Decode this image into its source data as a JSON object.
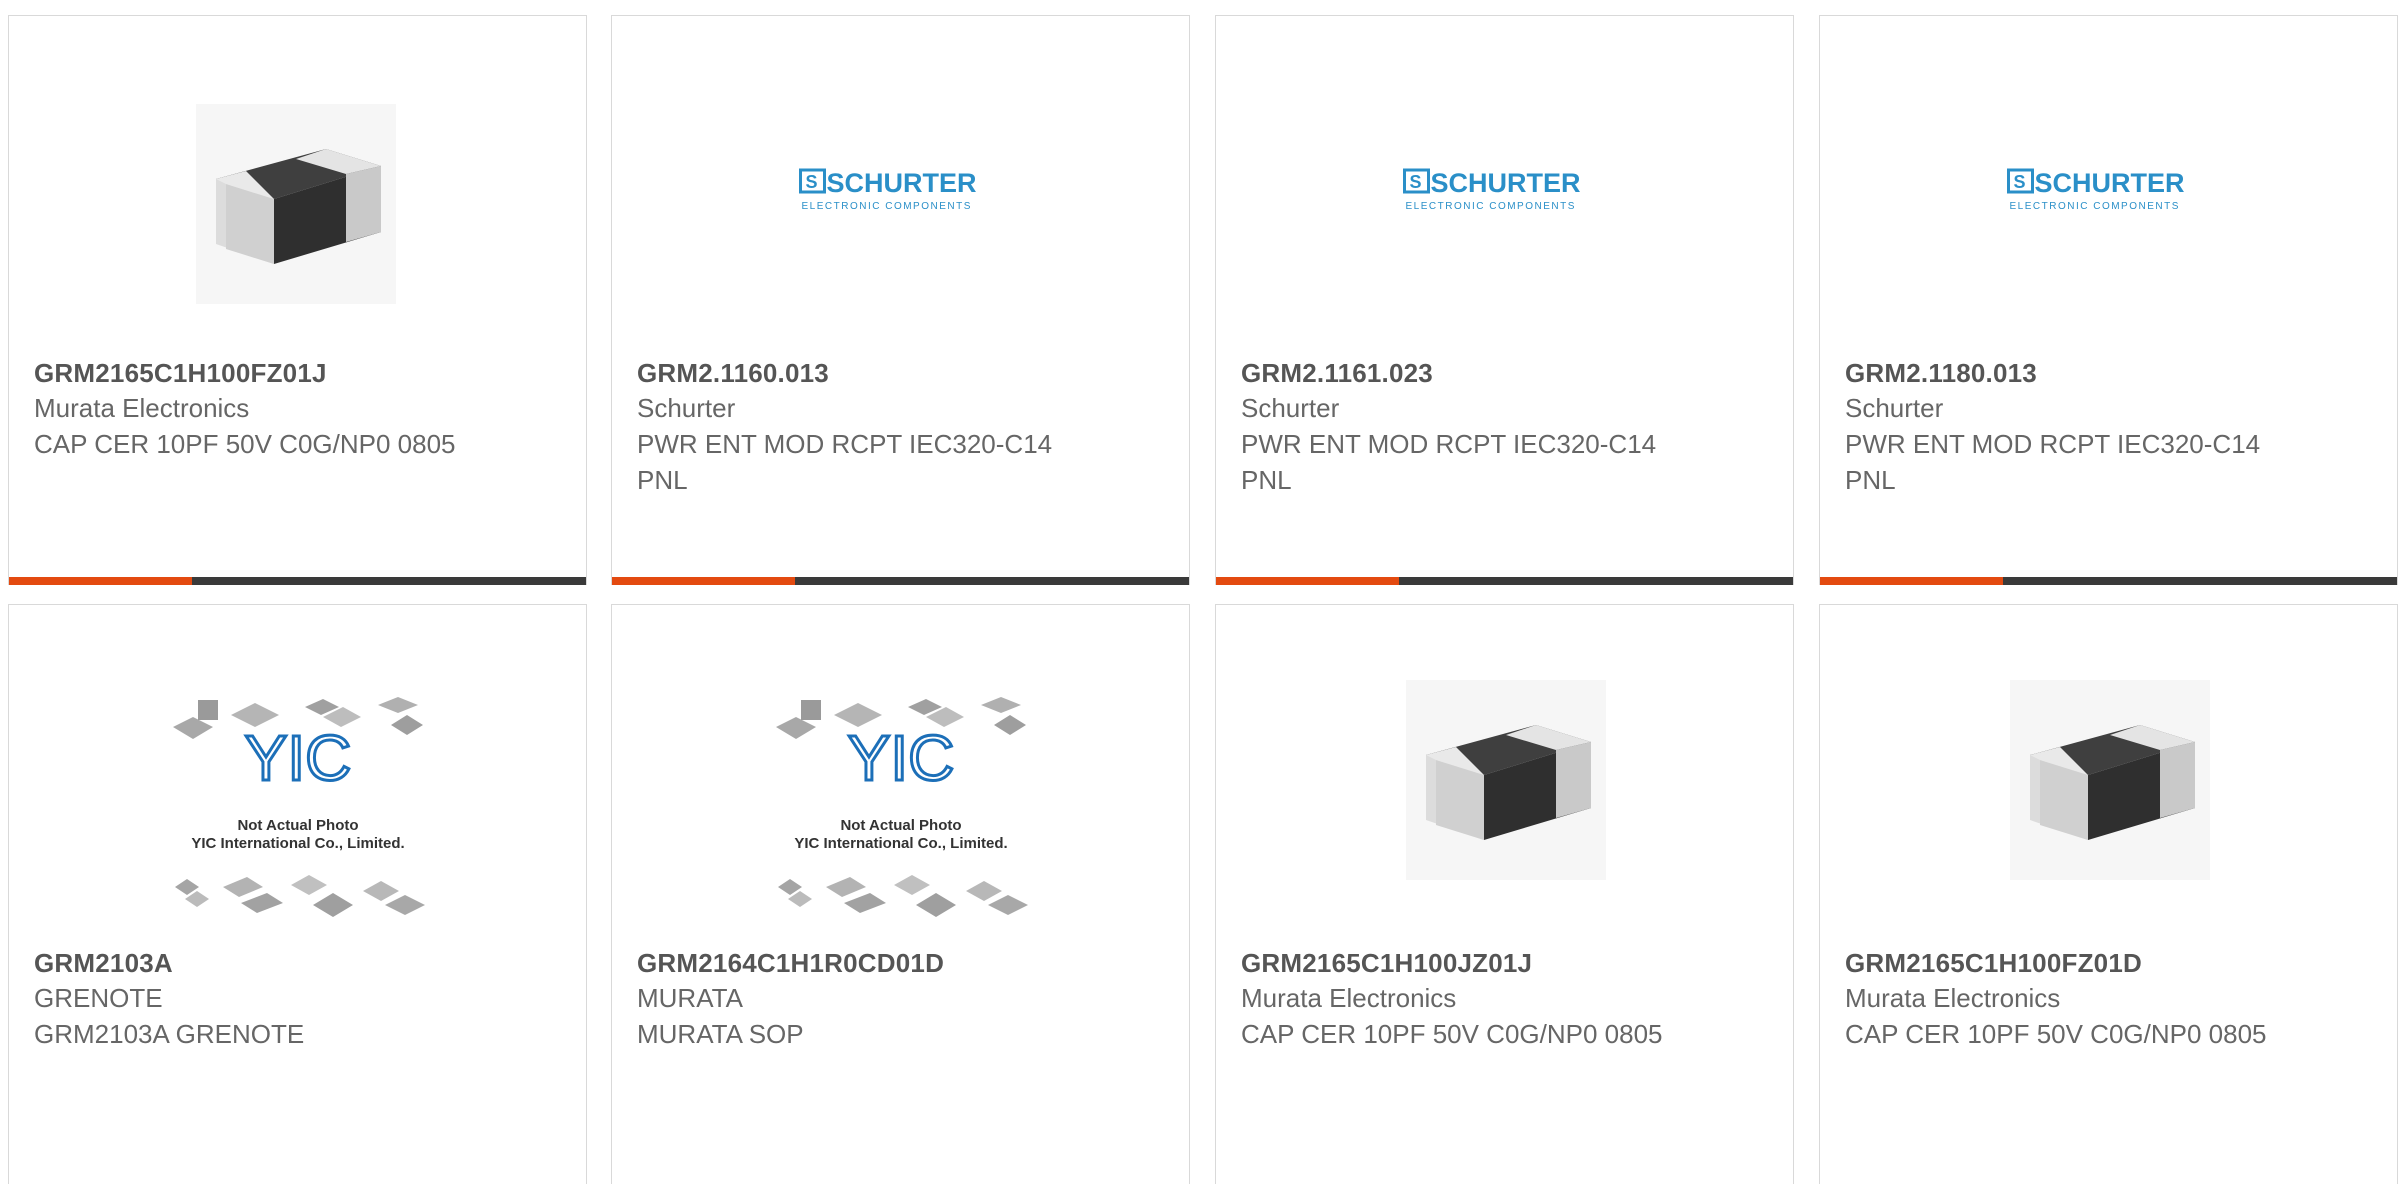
{
  "products": [
    {
      "part": "GRM2165C1H100FZ01J",
      "manufacturer": "Murata Electronics",
      "description": "CAP CER 10PF 50V C0G/NP0 0805",
      "image": "ceramic-capacitor-chip",
      "show_bar": true
    },
    {
      "part": "GRM2.1160.013",
      "manufacturer": "Schurter",
      "description": "PWR ENT MOD RCPT IEC320-C14 PNL",
      "image": "schurter-logo",
      "show_bar": true
    },
    {
      "part": "GRM2.1161.023",
      "manufacturer": "Schurter",
      "description": "PWR ENT MOD RCPT IEC320-C14 PNL",
      "image": "schurter-logo",
      "show_bar": true
    },
    {
      "part": "GRM2.1180.013",
      "manufacturer": "Schurter",
      "description": "PWR ENT MOD RCPT IEC320-C14 PNL",
      "image": "schurter-logo",
      "show_bar": true
    },
    {
      "part": "GRM2103A",
      "manufacturer": "GRENOTE",
      "description": "GRM2103A GRENOTE",
      "image": "yic-placeholder",
      "show_bar": false
    },
    {
      "part": "GRM2164C1H1R0CD01D",
      "manufacturer": "MURATA",
      "description": "MURATA SOP",
      "image": "yic-placeholder",
      "show_bar": false
    },
    {
      "part": "GRM2165C1H100JZ01J",
      "manufacturer": "Murata Electronics",
      "description": "CAP CER 10PF 50V C0G/NP0 0805",
      "image": "ceramic-capacitor-chip",
      "show_bar": false
    },
    {
      "part": "GRM2165C1H100FZ01D",
      "manufacturer": "Murata Electronics",
      "description": "CAP CER 10PF 50V C0G/NP0 0805",
      "image": "ceramic-capacitor-chip",
      "show_bar": false
    }
  ],
  "logo": {
    "schurter_brand": "SCHURTER",
    "schurter_tagline": "ELECTRONIC COMPONENTS",
    "yic_mark": "YIC",
    "yic_line1": "Not Actual Photo",
    "yic_line2": "YIC International Co., Limited."
  },
  "colors": {
    "accent": "#e34a10",
    "bar": "#3a3a3a",
    "schurter_blue": "#2a8fc8",
    "yic_blue": "#1c6fb8"
  }
}
